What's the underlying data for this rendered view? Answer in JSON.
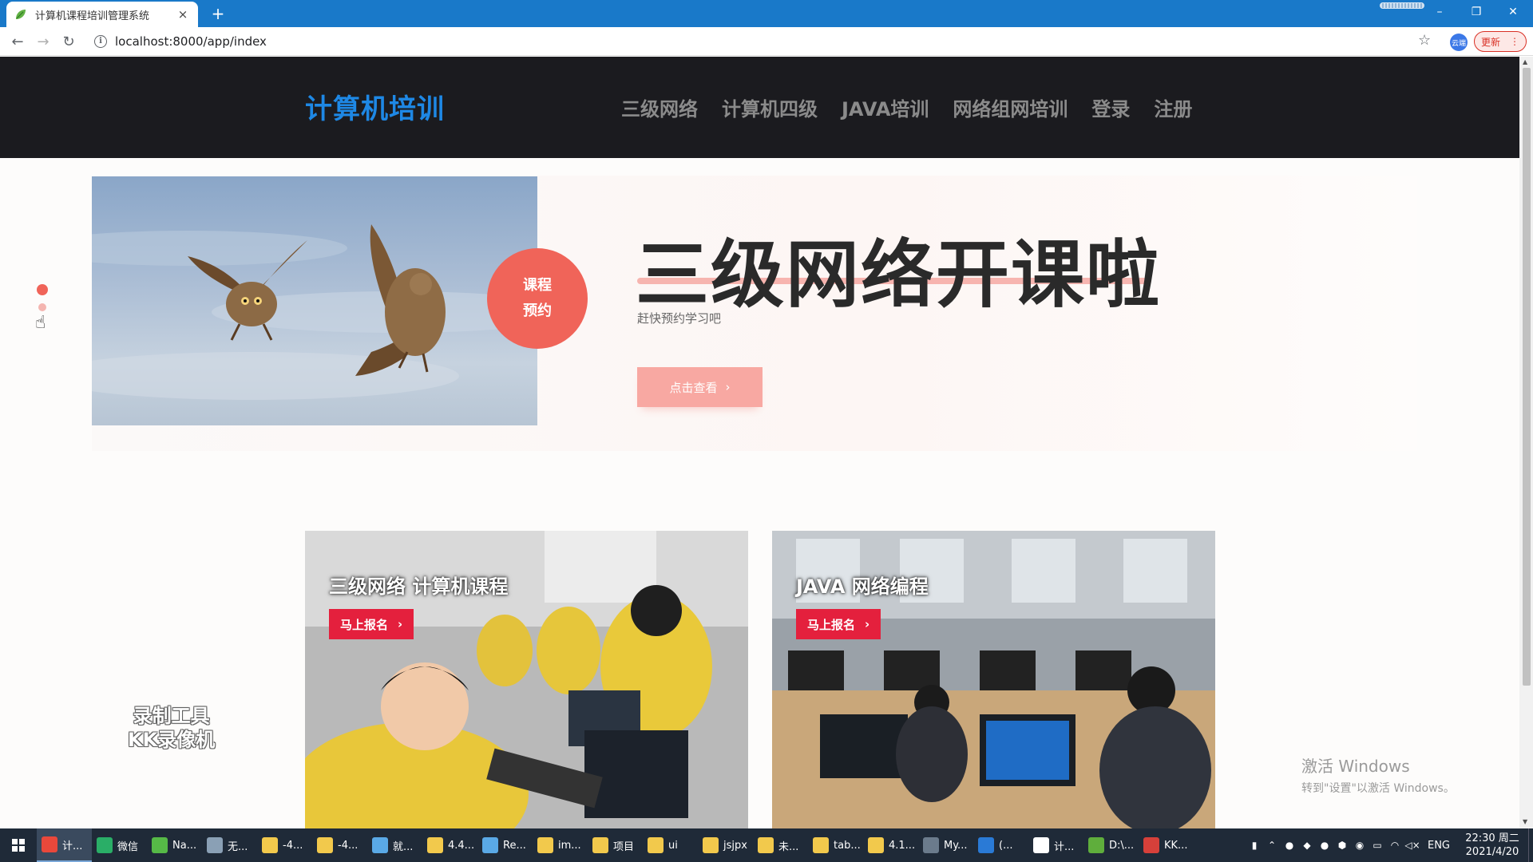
{
  "browser": {
    "tab_title": "计算机课程培训管理系统",
    "tab_close": "×",
    "new_tab": "+",
    "url": "localhost:8000/app/index",
    "update_label": "更新",
    "profile_label": "云端",
    "window_min": "–",
    "window_restore": "❐",
    "window_close": "✕"
  },
  "site": {
    "logo": "计算机培训",
    "nav": [
      "三级网络",
      "计算机四级",
      "JAVA培训",
      "网络组网培训",
      "登录",
      "注册"
    ]
  },
  "hero": {
    "badge_line1": "课程",
    "badge_line2": "预约",
    "title": "三级网络开课啦",
    "subtitle": "赶快预约学习吧",
    "button": "点击查看",
    "button_arrow": "›"
  },
  "slider_dots": [
    {
      "color": "#f06459"
    },
    {
      "color": "#f4b5b0"
    }
  ],
  "cards": [
    {
      "title": "三级网络 计算机课程",
      "button": "马上报名",
      "arrow": "›"
    },
    {
      "title": "JAVA 网络编程",
      "button": "马上报名",
      "arrow": "›"
    }
  ],
  "watermark": {
    "line1": "录制工具",
    "line2": "KK录像机"
  },
  "activation": {
    "line1": "激活 Windows",
    "line2": "转到\"设置\"以激活 Windows。"
  },
  "taskbar": {
    "items": [
      {
        "icon": "chrome-icon",
        "label": "计...",
        "color": "#e9483b",
        "active": true
      },
      {
        "icon": "wechat-icon",
        "label": "微信",
        "color": "#2aae67"
      },
      {
        "icon": "navicat-icon",
        "label": "Na...",
        "color": "#56b947"
      },
      {
        "icon": "app-icon",
        "label": "无...",
        "color": "#8aa0b5"
      },
      {
        "icon": "folder-icon",
        "label": "-4...",
        "color": "#f2c94c"
      },
      {
        "icon": "folder-icon",
        "label": "-4...",
        "color": "#f2c94c"
      },
      {
        "icon": "file-icon",
        "label": "就...",
        "color": "#5aa9e6"
      },
      {
        "icon": "folder-icon",
        "label": "4.4...",
        "color": "#f2c94c"
      },
      {
        "icon": "file-icon",
        "label": "Re...",
        "color": "#5aa9e6"
      },
      {
        "icon": "folder-icon",
        "label": "im...",
        "color": "#f2c94c"
      },
      {
        "icon": "folder-icon",
        "label": "项目",
        "color": "#f2c94c"
      },
      {
        "icon": "folder-icon",
        "label": "ui",
        "color": "#f2c94c"
      },
      {
        "icon": "folder-icon",
        "label": "jsjpx",
        "color": "#f2c94c"
      },
      {
        "icon": "folder-icon",
        "label": "未...",
        "color": "#f2c94c"
      },
      {
        "icon": "folder-icon",
        "label": "tab...",
        "color": "#f2c94c"
      },
      {
        "icon": "folder-icon",
        "label": "4.1...",
        "color": "#f2c94c"
      },
      {
        "icon": "tool-icon",
        "label": "My...",
        "color": "#6b7b8c"
      },
      {
        "icon": "vscode-icon",
        "label": "(...",
        "color": "#2a7ad6"
      },
      {
        "icon": "chat-icon",
        "label": "计...",
        "color": "#ffffff"
      },
      {
        "icon": "editor-icon",
        "label": "D:\\...",
        "color": "#5fae3c"
      },
      {
        "icon": "kk-icon",
        "label": "KK...",
        "color": "#d6403a"
      }
    ],
    "language": "ENG",
    "time": "22:30 周二",
    "date": "2021/4/20"
  }
}
